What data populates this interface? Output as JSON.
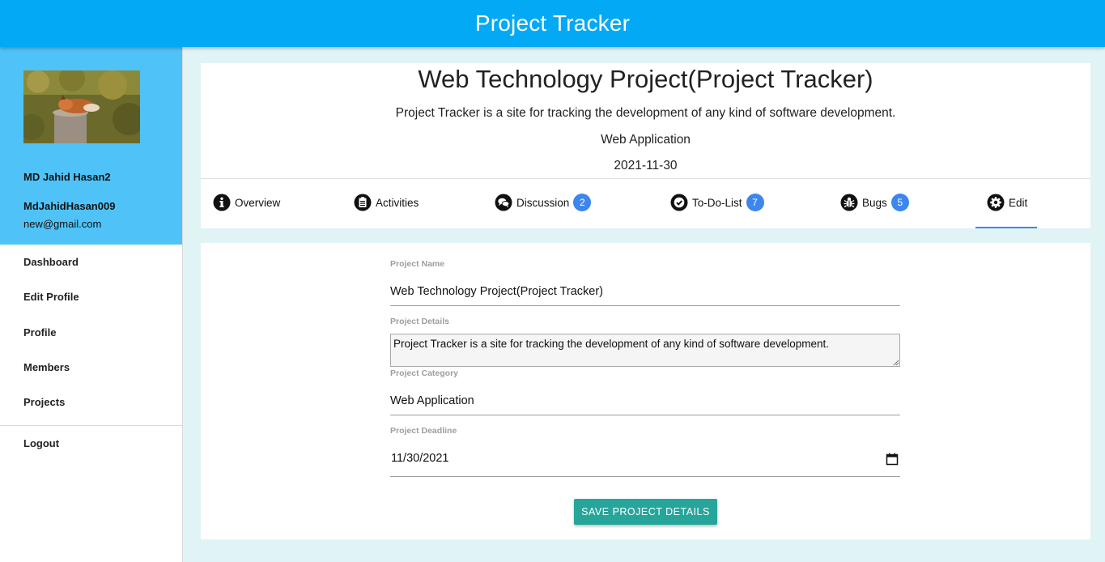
{
  "app": {
    "title": "Project Tracker"
  },
  "profile": {
    "name": "MD Jahid Hasan2",
    "username": "MdJahidHasan009",
    "email": "new@gmail.com",
    "avatar": "fox-photo"
  },
  "sidebar": {
    "items": [
      {
        "label": "Dashboard"
      },
      {
        "label": "Edit Profile"
      },
      {
        "label": "Profile"
      },
      {
        "label": "Members"
      },
      {
        "label": "Projects"
      }
    ],
    "logout": "Logout"
  },
  "project": {
    "title": "Web Technology Project(Project Tracker)",
    "description": "Project Tracker is a site for tracking the development of any kind of software development.",
    "category": "Web Application",
    "deadline": "2021-11-30"
  },
  "tabs": [
    {
      "label": "Overview",
      "icon": "info-icon"
    },
    {
      "label": "Activities",
      "icon": "clipboard-icon"
    },
    {
      "label": "Discussion",
      "icon": "chat-icon",
      "badge": "2"
    },
    {
      "label": "To-Do-List",
      "icon": "check-circle-icon",
      "badge": "7"
    },
    {
      "label": "Bugs",
      "icon": "bug-icon",
      "badge": "5"
    },
    {
      "label": "Edit",
      "icon": "gear-icon",
      "active": true
    }
  ],
  "form": {
    "name_label": "Project Name",
    "name_value": "Web Technology Project(Project Tracker)",
    "details_label": "Project Details",
    "details_value": "Project Tracker is a site for tracking the development of any kind of software development.",
    "category_label": "Project Category",
    "category_value": "Web Application",
    "deadline_label": "Project Deadline",
    "deadline_value": "11/30/2021",
    "save_label": "SAVE PROJECT DETAILS"
  },
  "colors": {
    "topbar": "#03a9f4",
    "profile_panel": "#4fc3f7",
    "badge": "#3d86ec",
    "save_button": "#26a69a",
    "page_background": "#e0f4f6"
  }
}
